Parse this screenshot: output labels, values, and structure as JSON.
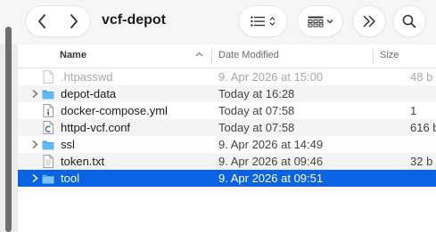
{
  "toolbar": {
    "title": "vcf-depot"
  },
  "columns": {
    "name": "Name",
    "date": "Date Modified",
    "size": "Size"
  },
  "rows": [
    {
      "name": ".htpasswd",
      "date": "9. Apr 2026 at 15:00",
      "size": "48 b",
      "kind": "file",
      "icon": "document-icon",
      "dim": true
    },
    {
      "name": "depot-data",
      "date": "Today at 16:28",
      "size": "",
      "kind": "folder",
      "icon": "folder-icon"
    },
    {
      "name": "docker-compose.yml",
      "date": "Today at 07:58",
      "size": "1",
      "kind": "file",
      "icon": "yaml-file-icon"
    },
    {
      "name": "httpd-vcf.conf",
      "date": "Today at 07:58",
      "size": "616 b",
      "kind": "file",
      "icon": "conf-file-icon"
    },
    {
      "name": "ssl",
      "date": "9. Apr 2026 at 14:49",
      "size": "",
      "kind": "folder",
      "icon": "folder-icon"
    },
    {
      "name": "token.txt",
      "date": "9. Apr 2026 at 09:46",
      "size": "32 b",
      "kind": "file",
      "icon": "text-file-icon"
    },
    {
      "name": "tool",
      "date": "9. Apr 2026 at 09:51",
      "size": "",
      "kind": "folder",
      "icon": "folder-icon",
      "selected": true
    }
  ],
  "colors": {
    "selection": "#0a63e3",
    "folder": "#4aa8f0"
  }
}
